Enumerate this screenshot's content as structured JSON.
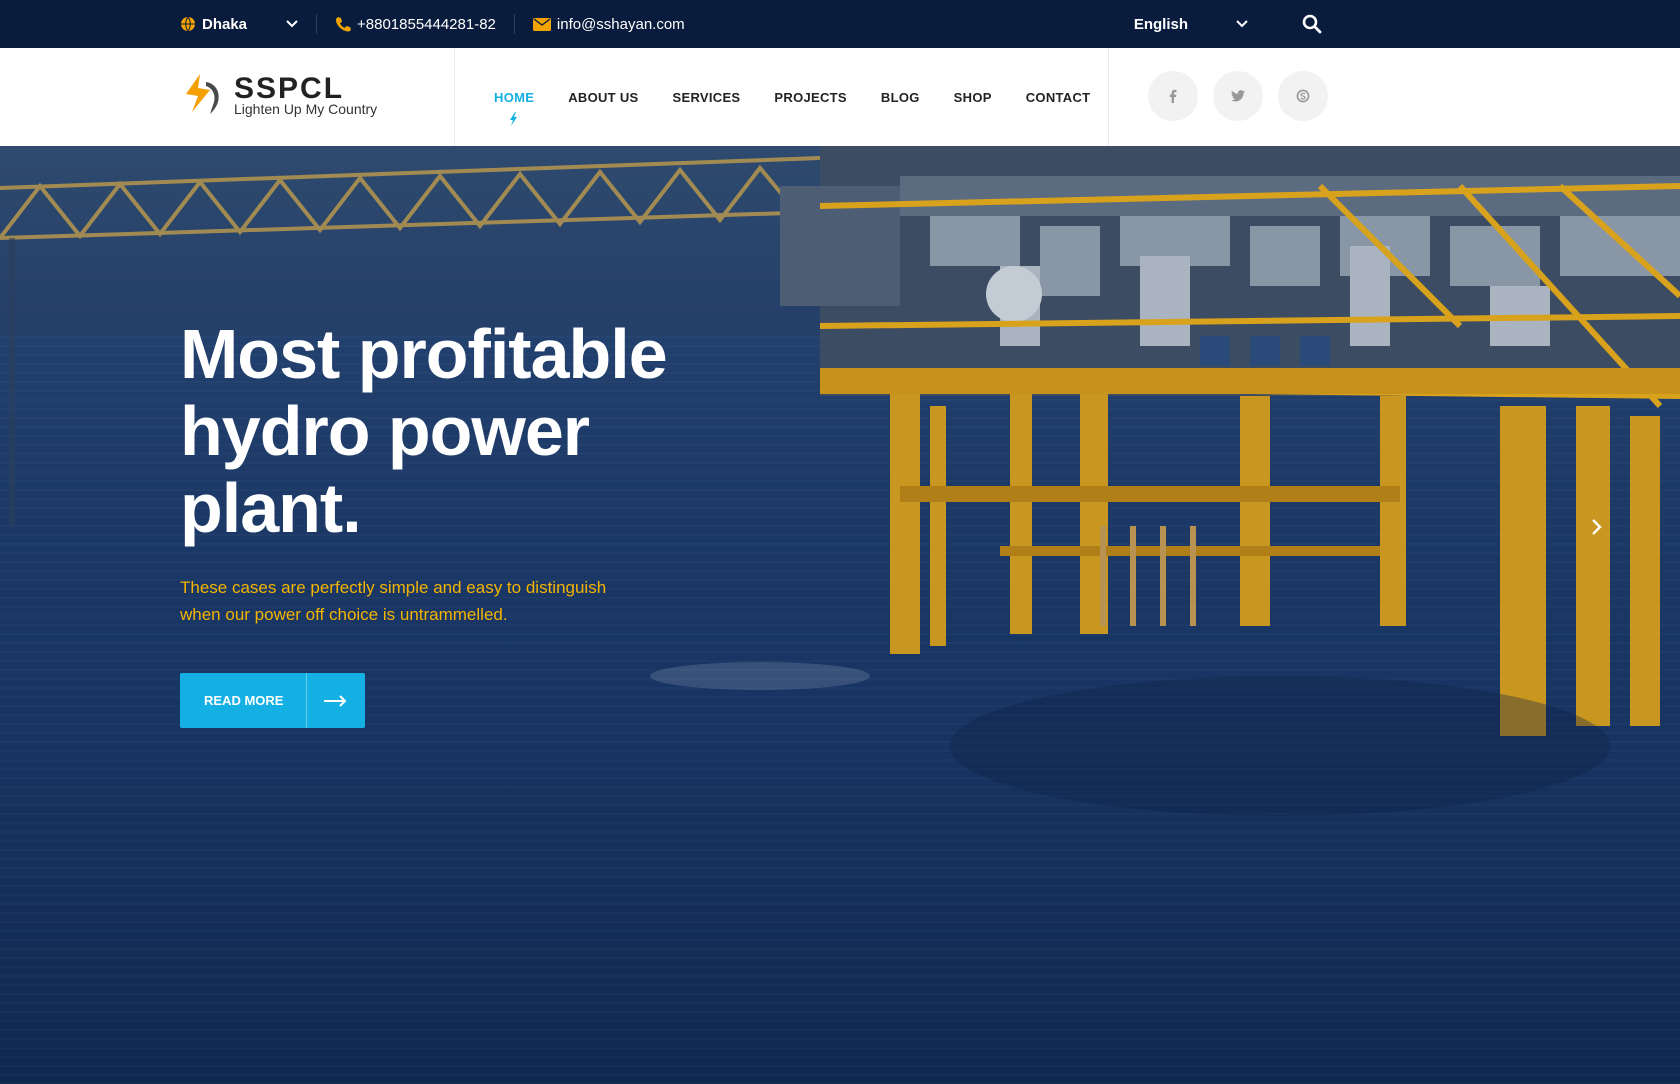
{
  "topbar": {
    "location": "Dhaka",
    "phone": "+8801855444281-82",
    "email": "info@sshayan.com",
    "language": "English"
  },
  "header": {
    "logo_name": "SSPCL",
    "logo_tagline": "Lighten Up My Country",
    "nav": [
      {
        "label": "HOME",
        "active": true
      },
      {
        "label": "ABOUT US"
      },
      {
        "label": "SERVICES"
      },
      {
        "label": "PROJECTS"
      },
      {
        "label": "BLOG"
      },
      {
        "label": "SHOP"
      },
      {
        "label": "CONTACT"
      }
    ],
    "socials": [
      {
        "icon": "facebook-icon",
        "glyph": "f"
      },
      {
        "icon": "twitter-icon",
        "glyph": "t"
      },
      {
        "icon": "skype-icon",
        "glyph": "s"
      }
    ]
  },
  "hero": {
    "title": "Most profitable hydro power plant.",
    "subtitle": "These cases are perfectly simple and easy to distinguish when our power off choice is untrammelled.",
    "button_label": "READ MORE"
  },
  "colors": {
    "topbar": "#0a1c3d",
    "accent": "#14b0e4",
    "subtitle": "#f4b400",
    "platform": "#d9a21c"
  }
}
